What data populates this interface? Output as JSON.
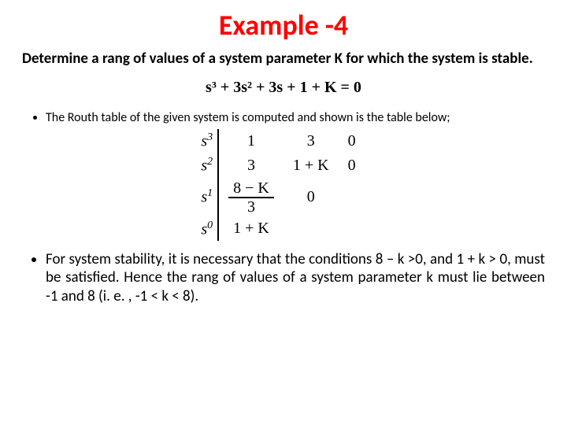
{
  "title": "Example -4",
  "prompt": "Determine a rang of values of a system parameter K for which the system is stable.",
  "equation": "s³ + 3s² + 3s + 1 + K = 0",
  "bullet1": "The Routh table of the given system is computed and shown is the table below;",
  "routh": {
    "r0": {
      "pow": "s",
      "sup": "3",
      "c1": "1",
      "c2": "3",
      "c3": "0"
    },
    "r1": {
      "pow": "s",
      "sup": "2",
      "c1": "3",
      "c2": "1 + K",
      "c3": "0"
    },
    "r2": {
      "pow": "s",
      "sup": "1",
      "num": "8 − K",
      "den": "3",
      "c2": "0"
    },
    "r3": {
      "pow": "s",
      "sup": "0",
      "c1": "1 + K"
    }
  },
  "bullet2": "For system stability, it is necessary that the conditions  8 – k >0,  and 1 + k > 0, must be satisfied. Hence the rang of values of a system parameter k must lie between -1 and 8 (i. e. , -1 < k < 8)."
}
